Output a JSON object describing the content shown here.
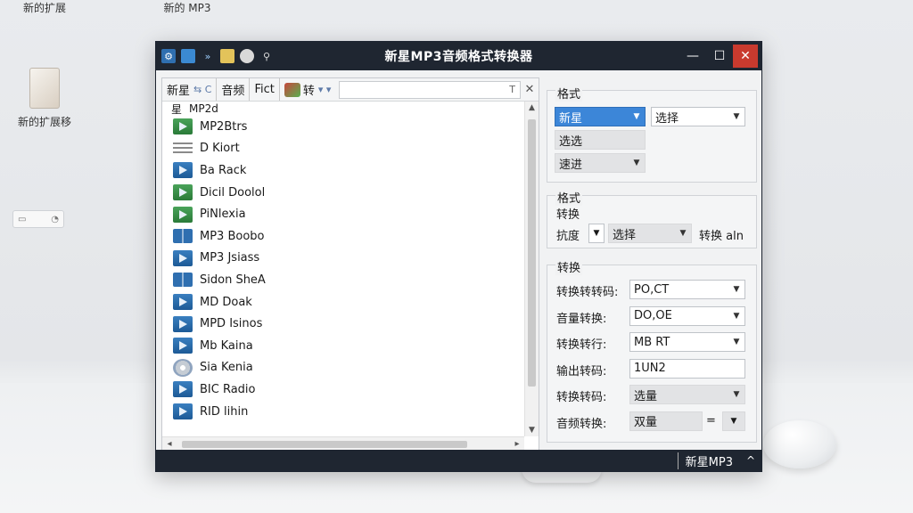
{
  "desktop": {
    "icons": [
      {
        "label": "新的扩展"
      },
      {
        "label": "新的 MP3"
      },
      {
        "label": "新的扩展移"
      }
    ]
  },
  "window": {
    "title": "新星MP3音频格式转换器",
    "controls": {
      "minimize": "—",
      "maximize": "☐",
      "close": "✕"
    }
  },
  "left_toolbar": {
    "tab_star": "新星",
    "tab_small": "⇆ C",
    "tab_audio": "音频",
    "tab_fict": "Fict",
    "tab_badge_label": "转",
    "search_mark": "T",
    "close": "✕"
  },
  "list": {
    "header_a": "星",
    "header_b": "MP2d",
    "items": [
      {
        "name": "MP2Btrs",
        "icon": "green"
      },
      {
        "name": "D Kiort",
        "icon": "bars"
      },
      {
        "name": "Ba Rack",
        "icon": "play"
      },
      {
        "name": "Dicil Doolol",
        "icon": "green"
      },
      {
        "name": "PiNlexia",
        "icon": "green"
      },
      {
        "name": "MP3 Boobo",
        "icon": "book"
      },
      {
        "name": "MP3 Jsiass",
        "icon": "play"
      },
      {
        "name": "Sidon SheA",
        "icon": "book"
      },
      {
        "name": "MD Doak",
        "icon": "play"
      },
      {
        "name": "MPD Isinos",
        "icon": "play"
      },
      {
        "name": "Mb Kaina",
        "icon": "play"
      },
      {
        "name": "Sia Kenia",
        "icon": "cd"
      },
      {
        "name": "BIC Radio",
        "icon": "play"
      },
      {
        "name": "RID lihin",
        "icon": "play"
      }
    ]
  },
  "format_group": {
    "title": "格式",
    "combo1": "新星",
    "combo2": "选择",
    "select_label": "选选",
    "speed_combo": "速进"
  },
  "convert_group": {
    "title": "格式",
    "sub": "转换",
    "left_label": "抗度",
    "combo": "选择",
    "right_label": "转换 aln"
  },
  "settings_group": {
    "title": "转换",
    "rows": [
      {
        "label": "转换转转码:",
        "value": "PO,CT"
      },
      {
        "label": "音量转换:",
        "value": "DO,OE"
      },
      {
        "label": "转换转行:",
        "value": "MB RT"
      },
      {
        "label": "输出转码:",
        "value": "1UN2"
      },
      {
        "label": "转换转码:",
        "value": "选量"
      },
      {
        "label": "音频转换:",
        "value": "双量",
        "extra": "="
      }
    ]
  },
  "statusbar": {
    "text": "新星MP3",
    "caret": "^"
  }
}
